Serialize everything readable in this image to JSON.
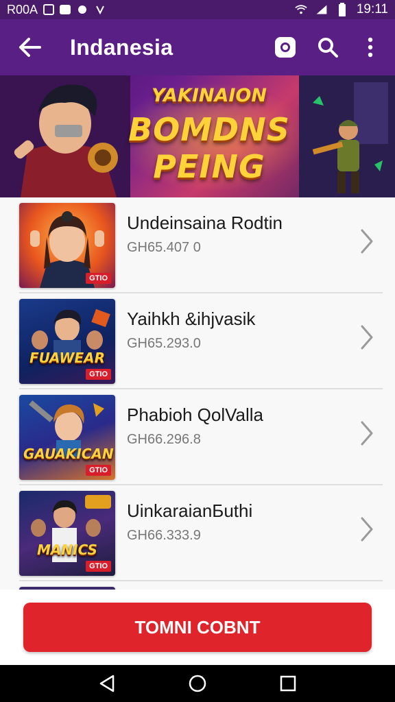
{
  "status_bar": {
    "carrier": "R00A",
    "time": "19:11",
    "icons": [
      "square-outline-icon",
      "mail-icon",
      "square-outline-icon",
      "notification-icon",
      "wifi-icon",
      "signal-icon",
      "battery-icon"
    ]
  },
  "app_bar": {
    "title": "Indanesia",
    "back_icon": "arrow-left-icon",
    "actions": [
      "instagram-icon",
      "search-icon",
      "more-vert-icon"
    ]
  },
  "banner": {
    "line1": "YAKINAION",
    "line2": "BOMDNS",
    "line3": "PEING"
  },
  "items": [
    {
      "name": "Undeinsaina Rodtin",
      "price": "GH65.407 0",
      "tag": "GTIO",
      "art_text": ""
    },
    {
      "name": "Yaihkh &ihjvasik",
      "price": "GH65.293.0",
      "tag": "GTIO",
      "art_text": "FUAWEAR"
    },
    {
      "name": "Phabioh  QolValla",
      "price": "GH66.296.8",
      "tag": "GTIO",
      "art_text": "GAUAKICAN"
    },
    {
      "name": "UinkaraianБuthi",
      "price": "GH66.333.9",
      "tag": "GTIO",
      "art_text": "MANICS"
    }
  ],
  "cta": {
    "label": "TOMNI COBNT"
  },
  "colors": {
    "status_bar": "#4a1a6b",
    "app_bar": "#5a1f84",
    "accent_red": "#e0242c",
    "price_gray": "#777777"
  },
  "nav": [
    "back-triangle-icon",
    "home-circle-icon",
    "recents-square-icon"
  ]
}
